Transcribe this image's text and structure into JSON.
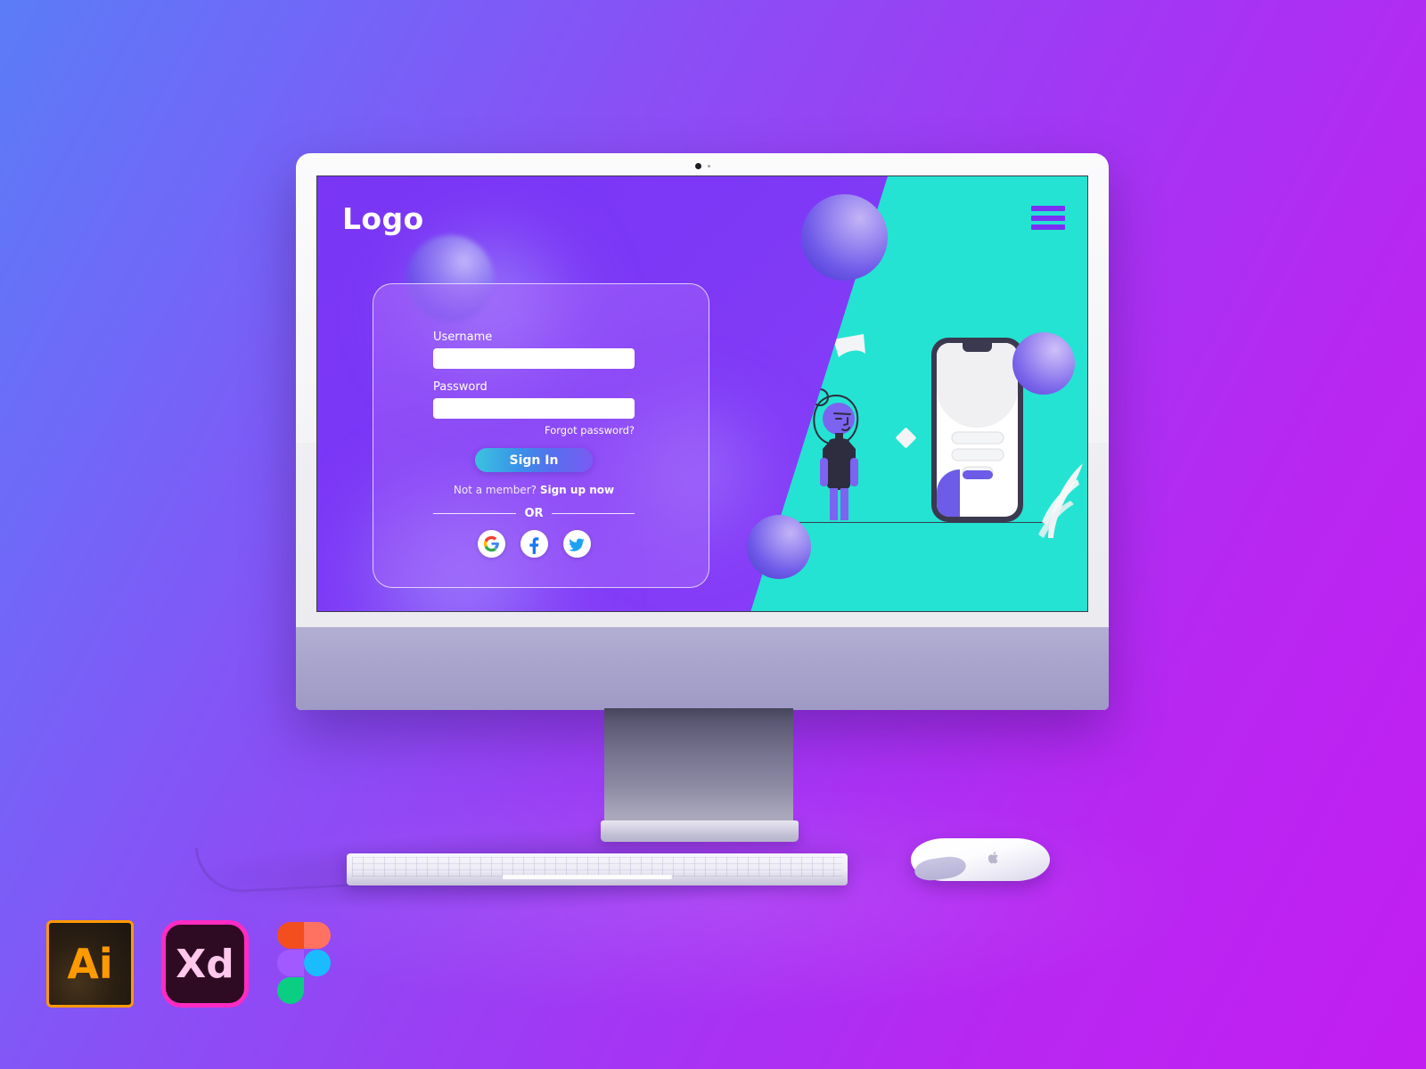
{
  "background": {
    "gradient_from": "#5b7cf7",
    "gradient_to": "#c21ef2"
  },
  "device": {
    "type": "desktop-monitor",
    "webcam_label": "webcam",
    "bezel_color": "#f7f7fa",
    "chin_color": "#a9a4cc",
    "stand_color": "#74728d"
  },
  "screen": {
    "left_panel_color": "#7c38f6",
    "right_panel_color": "#24e3d2",
    "brand": {
      "logo_text": "Logo"
    },
    "menu": {
      "icon": "hamburger-menu-icon",
      "bar_color": "#7b2ff5",
      "bars": 3
    },
    "login_form": {
      "username": {
        "label": "Username",
        "value": "",
        "placeholder": ""
      },
      "password": {
        "label": "Password",
        "value": "",
        "placeholder": ""
      },
      "forgot_password_link": "Forgot password?",
      "submit_button": "Sign In",
      "submit_gradient_from": "#3bc4e0",
      "submit_gradient_to": "#7a5bf2",
      "member_prompt": "Not a member?",
      "signup_link": "Sign up now",
      "divider_text": "OR",
      "social_buttons": [
        {
          "name": "google",
          "icon": "google-icon",
          "label": "G"
        },
        {
          "name": "facebook",
          "icon": "facebook-icon",
          "label": "f"
        },
        {
          "name": "twitter",
          "icon": "twitter-icon",
          "label": "bird"
        }
      ]
    },
    "illustration": {
      "character": "standing-person",
      "phone_mockup": "smartphone-login-screen",
      "decorations": [
        "sphere",
        "sphere",
        "sphere",
        "diamond",
        "flag-shape",
        "leaf"
      ],
      "phone_button_color": "#6c5ce7"
    }
  },
  "peripherals": {
    "keyboard": "wireless-keyboard",
    "mouse": "magic-mouse"
  },
  "footer": {
    "logos": [
      {
        "name": "adobe-illustrator",
        "label": "Ai",
        "accent": "#ff9a00"
      },
      {
        "name": "adobe-xd",
        "label": "Xd",
        "accent": "#ff2bc2"
      },
      {
        "name": "figma",
        "label": "",
        "accent": "#f24e1e"
      }
    ]
  }
}
